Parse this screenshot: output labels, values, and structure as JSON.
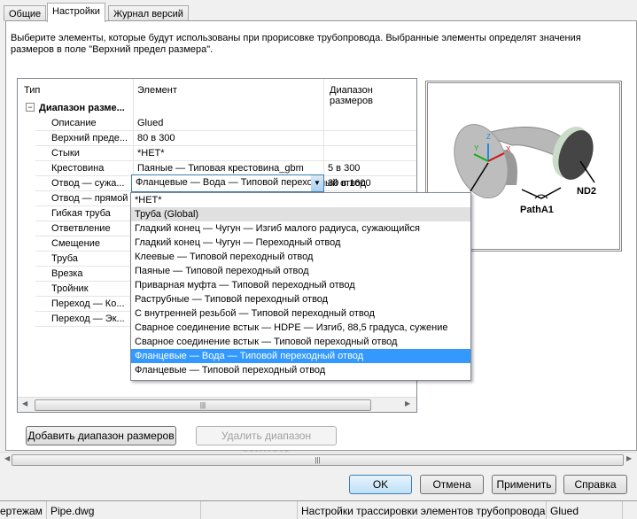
{
  "tabs": [
    {
      "label": "Общие"
    },
    {
      "label": "Настройки"
    },
    {
      "label": "Журнал версий"
    }
  ],
  "description": "Выберите элементы, которые будут использованы при прорисовке трубопровода. Выбранные элементы определят значения размеров в поле \"Верхний предел размера\".",
  "grid": {
    "columns": [
      "Тип",
      "Элемент",
      "Диапазон размеров"
    ],
    "group": "Диапазон разме...",
    "rows": [
      {
        "type": "Описание",
        "element": "Glued",
        "range": ""
      },
      {
        "type": "Верхний преде...",
        "element": "80 в 300",
        "range": ""
      },
      {
        "type": "Стыки",
        "element": "*НЕТ*",
        "range": ""
      },
      {
        "type": "Крестовина",
        "element": "Паяные — Типовая крестовина_gbm",
        "range": "5 в 300"
      },
      {
        "type": "Отвод — сужа...",
        "element": "Фланцевые — Вода — Типовой переходный отвод",
        "range": "80 в 1600"
      },
      {
        "type": "Отвод — прямой",
        "element": "*НЕТ*",
        "range": ""
      },
      {
        "type": "Гибкая труба",
        "element": "",
        "range": ""
      },
      {
        "type": "Ответвление",
        "element": "",
        "range": ""
      },
      {
        "type": "Смещение",
        "element": "",
        "range": ""
      },
      {
        "type": "Труба",
        "element": "",
        "range": ""
      },
      {
        "type": "Врезка",
        "element": "",
        "range": ""
      },
      {
        "type": "Тройник",
        "element": "",
        "range": ""
      },
      {
        "type": "Переход — Ко...",
        "element": "",
        "range": ""
      },
      {
        "type": "Переход — Эк...",
        "element": "",
        "range": ""
      }
    ]
  },
  "dropdown": {
    "options": [
      "*НЕТ*",
      "Труба (Global)",
      "Гладкий конец — Чугун — Изгиб малого радиуса, сужающийся",
      "Гладкий конец — Чугун — Переходный отвод",
      "Клеевые — Типовой переходный отвод",
      "Паяные — Типовой переходный отвод",
      "Приварная муфта — Типовой переходный отвод",
      "Раструбные — Типовой переходный отвод",
      "С внутренней резьбой — Типовой переходный отвод",
      "Сварное соединение встык — HDPE — Изгиб, 88,5 градуса, сужение",
      "Сварное соединение встык — Типовой переходный отвод",
      "Фланцевые — Вода — Типовой переходный отвод",
      "Фланцевые — Типовой переходный отвод"
    ],
    "selected_index": 11,
    "hover_index": 1
  },
  "preview": {
    "labels": {
      "nd2": "ND2",
      "path": "PathA1",
      "x": "X",
      "y": "Y",
      "z": "Z"
    }
  },
  "buttons": {
    "add": "Добавить диапазон размеров",
    "remove": "Удалить диапазон размеров",
    "ok": "OK",
    "cancel": "Отмена",
    "apply": "Применить",
    "help": "Справка"
  },
  "status": {
    "left": "ертежам",
    "file": "Pipe.dwg",
    "title": "Настройки трассировки элементов трубопровода",
    "style": "Glued"
  },
  "colors": {
    "selection": "#3399ff",
    "accent": "#3c7fb1"
  }
}
